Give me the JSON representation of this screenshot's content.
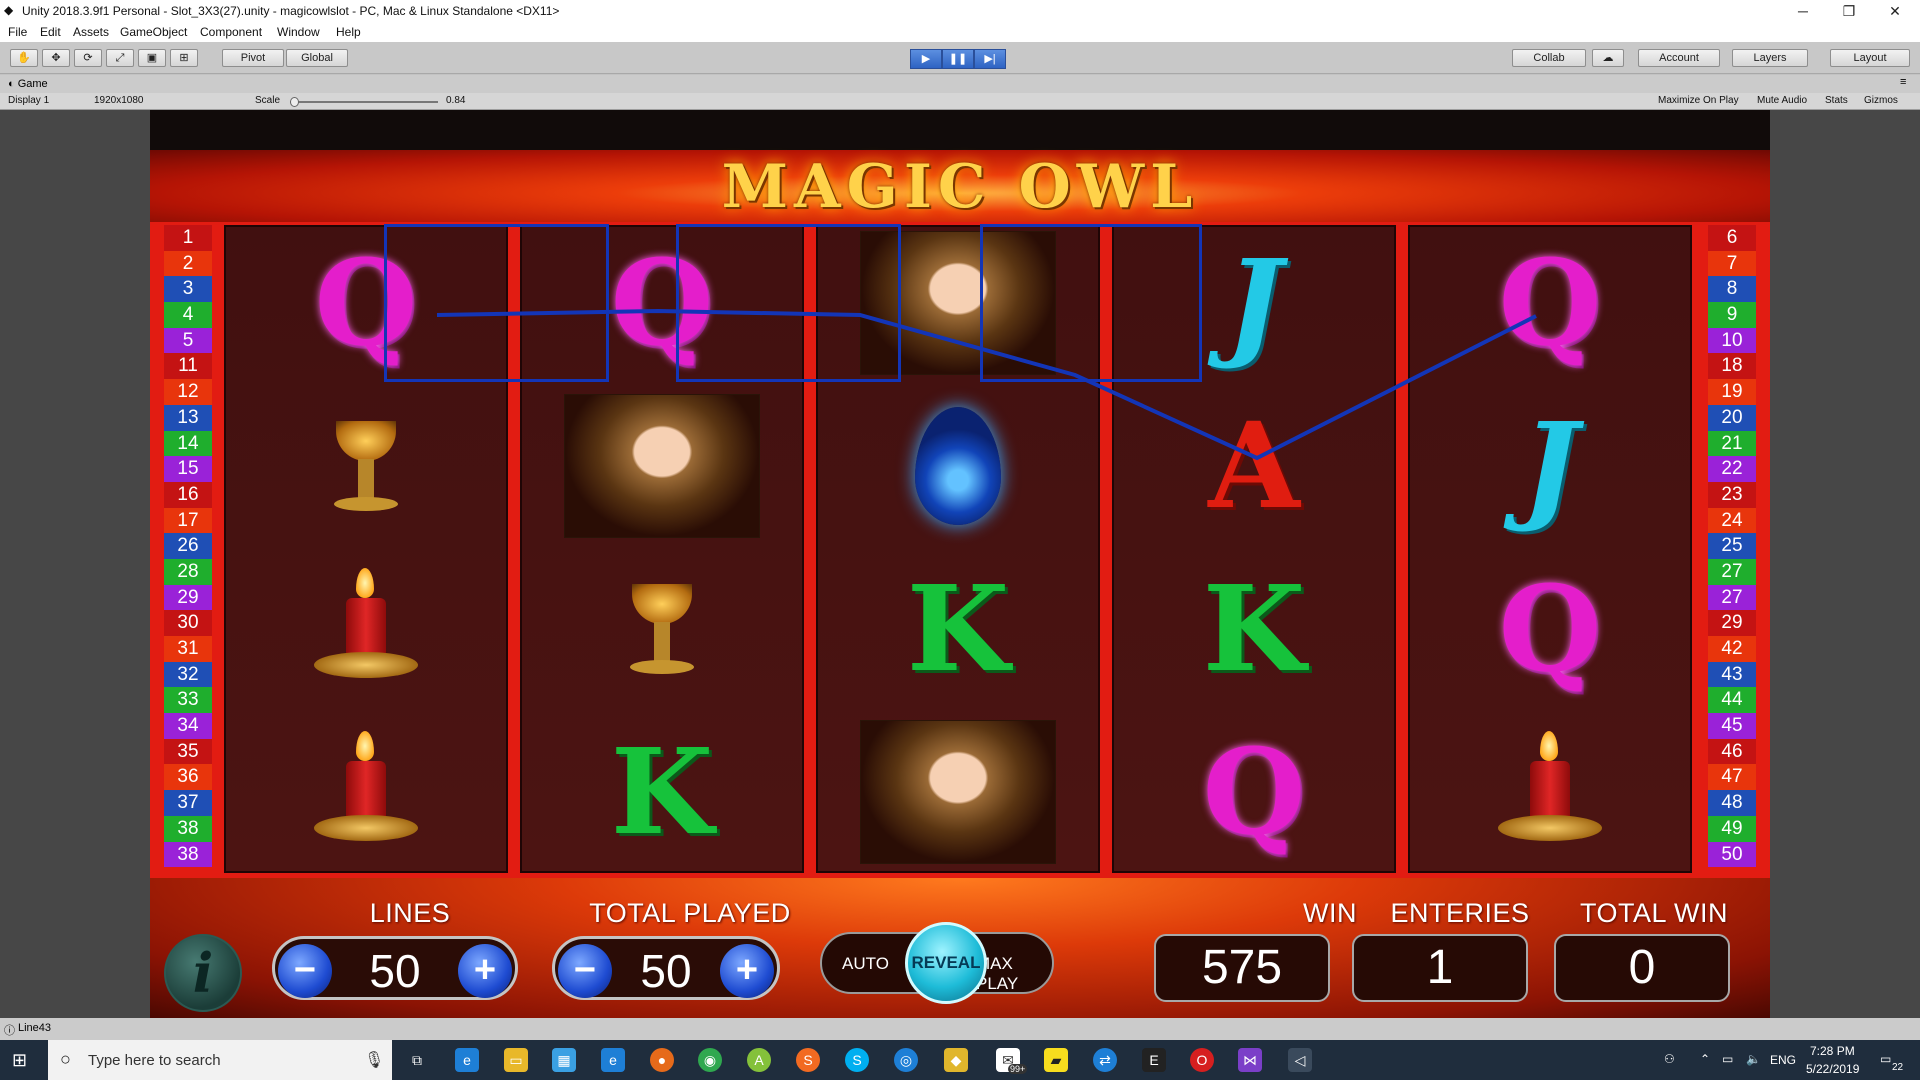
{
  "window": {
    "title": "Unity 2018.3.9f1 Personal - Slot_3X3(27).unity - magicowlslot - PC, Mac & Linux Standalone <DX11>",
    "minimize": "─",
    "maximize": "❐",
    "close": "✕"
  },
  "menu": [
    "File",
    "Edit",
    "Assets",
    "GameObject",
    "Component",
    "Window",
    "Help"
  ],
  "toolbar": {
    "pivot": "Pivot",
    "global": "Global",
    "collab": "Collab",
    "account": "Account",
    "layers": "Layers",
    "layout": "Layout"
  },
  "game_view": {
    "tab": "Game",
    "display": "Display 1",
    "resolution": "1920x1080",
    "scale_label": "Scale",
    "scale_value": "0.84",
    "scale_fraction": 0.84,
    "maximize_on_play": "Maximize On Play",
    "mute_audio": "Mute Audio",
    "stats": "Stats",
    "gizmos": "Gizmos"
  },
  "game": {
    "title": "MAGIC OWL",
    "left_line_numbers": [
      "1",
      "2",
      "3",
      "4",
      "5",
      "11",
      "12",
      "13",
      "14",
      "15",
      "16",
      "17",
      "26",
      "28",
      "29",
      "30",
      "31",
      "32",
      "33",
      "34",
      "35",
      "36",
      "37",
      "38",
      "38"
    ],
    "right_line_numbers": [
      "6",
      "7",
      "8",
      "9",
      "10",
      "18",
      "19",
      "20",
      "21",
      "22",
      "23",
      "24",
      "25",
      "27",
      "27",
      "29",
      "42",
      "43",
      "44",
      "45",
      "46",
      "47",
      "48",
      "49",
      "50"
    ],
    "number_colors": [
      "#c41313",
      "#e8350c",
      "#1f4fb5",
      "#1fae2d",
      "#9a22d8"
    ],
    "reels": [
      [
        "Q",
        "goblet",
        "candle",
        "candle"
      ],
      [
        "Q",
        "witch",
        "goblet",
        "K"
      ],
      [
        "witch",
        "gem",
        "K",
        "witch"
      ],
      [
        "J",
        "A",
        "K",
        "Q"
      ],
      [
        "Q",
        "J",
        "Q",
        "candle"
      ]
    ],
    "labels": {
      "lines": "LINES",
      "total_played": "TOTAL PLAYED",
      "win": "WIN",
      "enteries": "ENTERIES",
      "total_win": "TOTAL WIN"
    },
    "lines_value": "50",
    "total_played_value": "50",
    "auto": "AUTO",
    "reveal": "REVEAL",
    "max_play": "MAX PLAY",
    "win_value": "575",
    "enteries_value": "1",
    "total_win_value": "0",
    "info_glyph": "i",
    "minus": "−",
    "plus": "+"
  },
  "status": {
    "text": "Line43"
  },
  "taskbar": {
    "search_placeholder": "Type here to search",
    "language": "ENG",
    "time": "7:28 PM",
    "date": "5/22/2019",
    "notification_count": "22",
    "store_badge": "99+"
  }
}
